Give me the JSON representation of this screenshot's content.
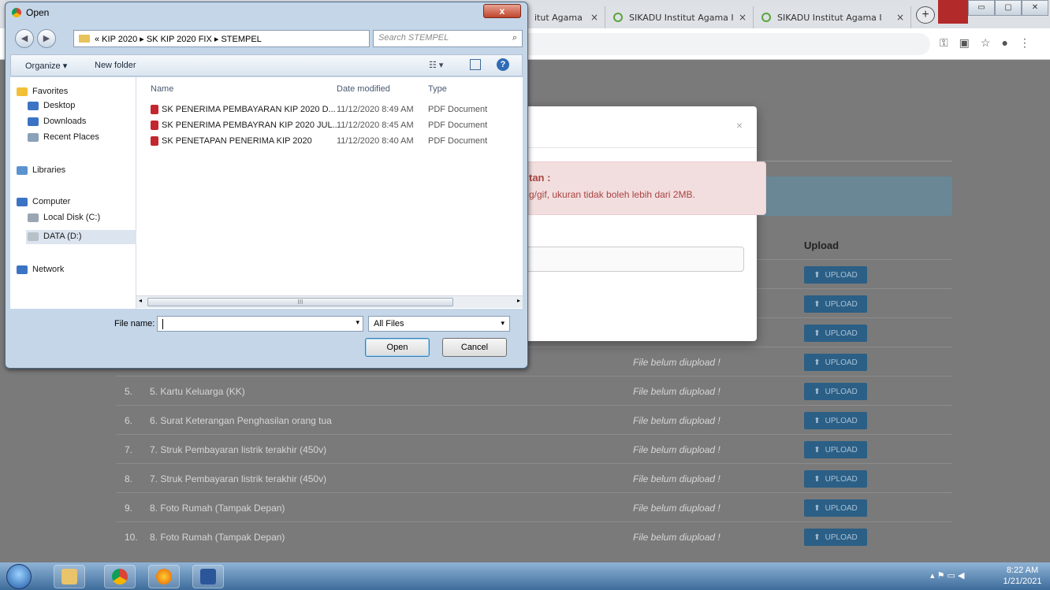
{
  "browser": {
    "tabs": [
      {
        "label": "itut Agama I"
      },
      {
        "label": "SIKADU Institut Agama I"
      },
      {
        "label": "SIKADU Institut Agama I"
      }
    ],
    "tab_close": "×",
    "newtab": "+",
    "window_controls": [
      "▭",
      "▢",
      "✕"
    ],
    "toolbar_icons": [
      "key-icon",
      "translate-icon",
      "star-icon",
      "account-icon",
      "menu-icon"
    ],
    "toolbar_glyphs": [
      "⚿",
      "▣",
      "☆",
      "●",
      "⋮"
    ]
  },
  "page": {
    "upload_header": "Upload",
    "modal": {
      "close": "×",
      "alert_title": "tan :",
      "alert_body": "g/gif, ukuran tidak boleh lebih dari 2MB."
    },
    "rows": [
      {
        "no": "",
        "doc": "",
        "status": ""
      },
      {
        "no": "",
        "doc": "",
        "status": ""
      },
      {
        "no": "",
        "doc": "",
        "status": ""
      },
      {
        "no": "",
        "doc": "",
        "status": "File belum diupload !"
      },
      {
        "no": "5.",
        "doc": "5. Kartu Keluarga (KK)",
        "status": "File belum diupload !"
      },
      {
        "no": "6.",
        "doc": "6. Surat Keterangan Penghasilan orang tua",
        "status": "File belum diupload !"
      },
      {
        "no": "7.",
        "doc": "7. Struk Pembayaran listrik terakhir (450v)",
        "status": "File belum diupload !"
      },
      {
        "no": "8.",
        "doc": "7. Struk Pembayaran listrik terakhir (450v)",
        "status": "File belum diupload !"
      },
      {
        "no": "9.",
        "doc": "8. Foto Rumah (Tampak Depan)",
        "status": "File belum diupload !"
      },
      {
        "no": "10.",
        "doc": "8. Foto Rumah (Tampak Depan)",
        "status": "File belum diupload !"
      }
    ],
    "upload_button": "UPLOAD",
    "upload_glyph": "⬆"
  },
  "dialog": {
    "title": "Open",
    "close": "x",
    "path": "« KIP 2020 ▸ SK KIP 2020 FIX ▸ STEMPEL",
    "search_placeholder": "Search STEMPEL",
    "organize": "Organize ▾",
    "new_folder": "New folder",
    "views_glyph": "☷ ▾",
    "help": "?",
    "nav": {
      "favorites": "Favorites",
      "desktop": "Desktop",
      "downloads": "Downloads",
      "recent": "Recent Places",
      "libraries": "Libraries",
      "computer": "Computer",
      "local_disk": "Local Disk (C:)",
      "data_disk": "DATA (D:)",
      "network": "Network"
    },
    "columns": {
      "name": "Name",
      "date": "Date modified",
      "type": "Type"
    },
    "files": [
      {
        "name": "SK PENERIMA PEMBAYARAN KIP 2020  D...",
        "date": "11/12/2020 8:49 AM",
        "type": "PDF Document"
      },
      {
        "name": "SK PENERIMA PEMBAYRAN KIP 2020 JUL...",
        "date": "11/12/2020 8:45 AM",
        "type": "PDF Document"
      },
      {
        "name": "SK PENETAPAN PENERIMA KIP 2020",
        "date": "11/12/2020 8:40 AM",
        "type": "PDF Document"
      }
    ],
    "file_name_label": "File name:",
    "file_name_value": "",
    "file_type": "All Files",
    "open_button": "Open",
    "cancel_button": "Cancel",
    "scroll_left": "◂",
    "scroll_right": "▸",
    "scroll_thumb": "III"
  },
  "taskbar": {
    "time": "8:22 AM",
    "date": "1/21/2021",
    "tray": "▴  ⚑  ▭  ◀"
  }
}
